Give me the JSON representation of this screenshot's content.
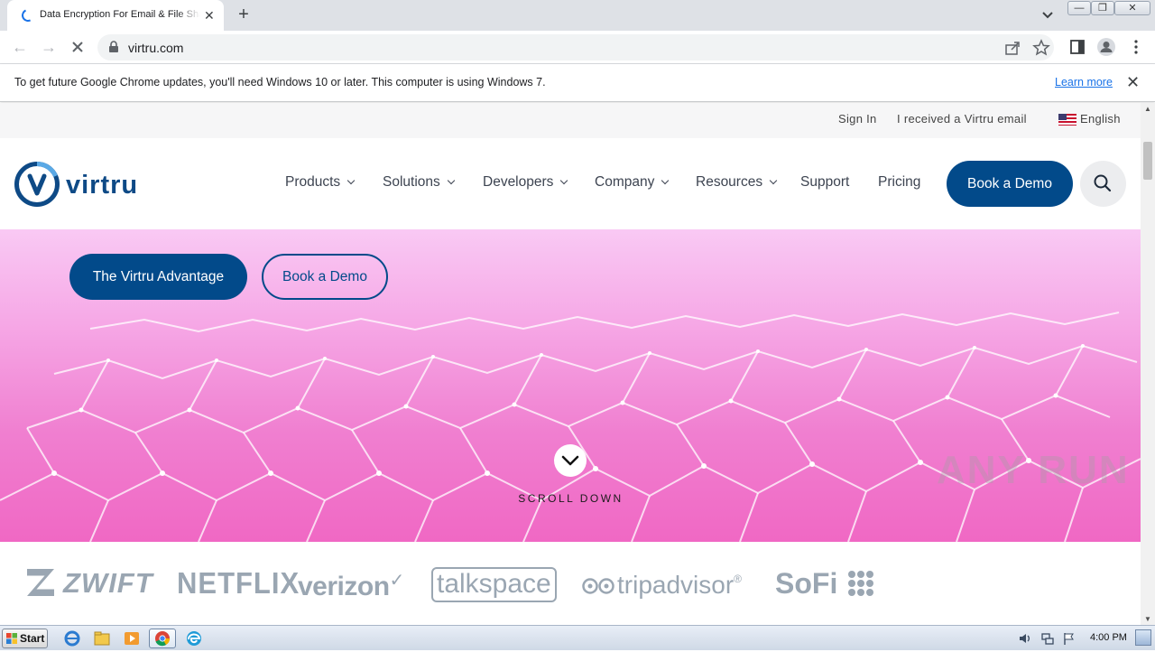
{
  "browser": {
    "tab_title": "Data Encryption For Email & File Sharing | Virtru",
    "url": "virtru.com",
    "infobar_message": "To get future Google Chrome updates, you'll need Windows 10 or later. This computer is using Windows 7.",
    "infobar_link": "Learn more"
  },
  "site": {
    "util": {
      "sign_in": "Sign In",
      "received_email": "I received a Virtru email",
      "language": "English"
    },
    "logo_text": "virtru",
    "nav": {
      "items": [
        {
          "label": "Products",
          "dropdown": true
        },
        {
          "label": "Solutions",
          "dropdown": true
        },
        {
          "label": "Developers",
          "dropdown": true
        },
        {
          "label": "Company",
          "dropdown": true
        },
        {
          "label": "Resources",
          "dropdown": true
        },
        {
          "label": "Support",
          "dropdown": false
        },
        {
          "label": "Pricing",
          "dropdown": false
        }
      ],
      "cta": "Book a Demo"
    },
    "hero": {
      "primary_button": "The Virtru Advantage",
      "secondary_button": "Book a Demo",
      "scroll_label": "SCROLL DOWN"
    },
    "customer_logos": [
      "ZWIFT",
      "NETFLIX",
      "verizon",
      "talkspace",
      "tripadvisor",
      "SoFi"
    ]
  },
  "watermark": "ANY RUN",
  "taskbar": {
    "start_label": "Start",
    "clock": "4:00 PM"
  },
  "colors": {
    "brand_navy": "#024a8a",
    "hero_pink": "#f07fd0",
    "chrome_frame": "#dee1e6",
    "logo_gray": "#9aa6b2"
  }
}
